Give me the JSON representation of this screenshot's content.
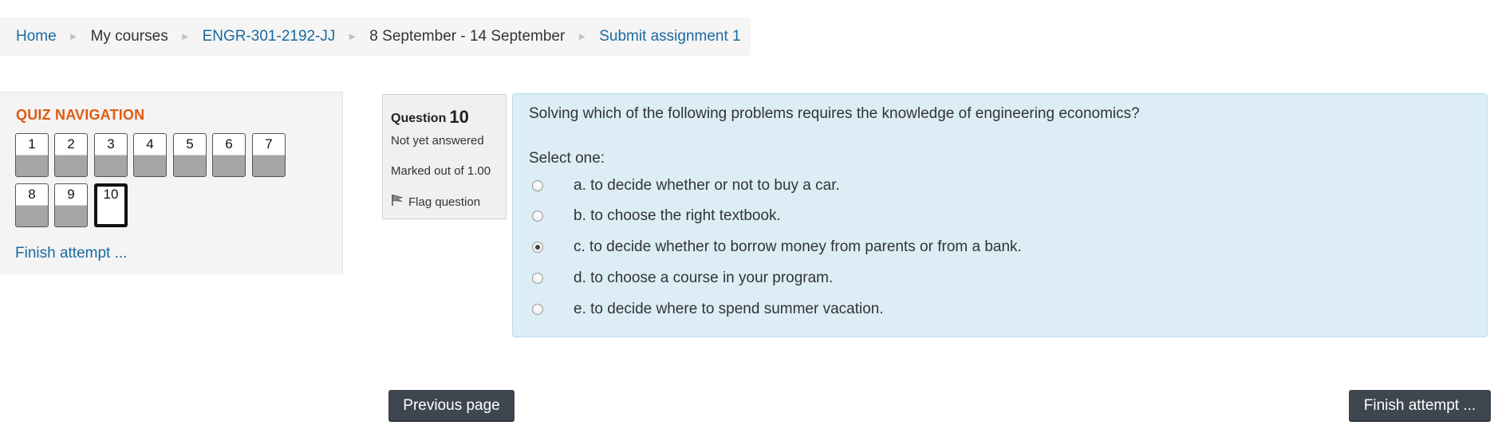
{
  "breadcrumb": {
    "items": [
      {
        "label": "Home",
        "link": true
      },
      {
        "label": "My courses",
        "link": false
      },
      {
        "label": "ENGR-301-2192-JJ",
        "link": true
      },
      {
        "label": "8 September - 14 September",
        "link": false
      },
      {
        "label": "Submit assignment 1",
        "link": true
      }
    ],
    "separator": "►"
  },
  "quiz_nav": {
    "title": "QUIZ NAVIGATION",
    "buttons": [
      "1",
      "2",
      "3",
      "4",
      "5",
      "6",
      "7",
      "8",
      "9",
      "10"
    ],
    "current": "10",
    "finish_link": "Finish attempt ..."
  },
  "question_info": {
    "label": "Question",
    "number": "10",
    "state": "Not yet answered",
    "grade": "Marked out of 1.00",
    "flag": "Flag question"
  },
  "question": {
    "text": "Solving which of the following problems requires the knowledge of engineering economics?",
    "prompt": "Select one:",
    "answers": [
      {
        "label": "a. to decide whether or not to buy a car.",
        "checked": false
      },
      {
        "label": "b. to choose the right textbook.",
        "checked": false
      },
      {
        "label": "c. to decide whether to borrow money from parents or from a bank.",
        "checked": true
      },
      {
        "label": "d. to choose a course in your program.",
        "checked": false
      },
      {
        "label": "e. to decide where to spend summer vacation.",
        "checked": false
      }
    ]
  },
  "buttons": {
    "previous": "Previous page",
    "finish": "Finish attempt ..."
  },
  "colors": {
    "link": "#1a6aa0",
    "nav_title": "#e05a10",
    "question_bg": "#dcedf6",
    "button_bg": "#3e4650"
  }
}
